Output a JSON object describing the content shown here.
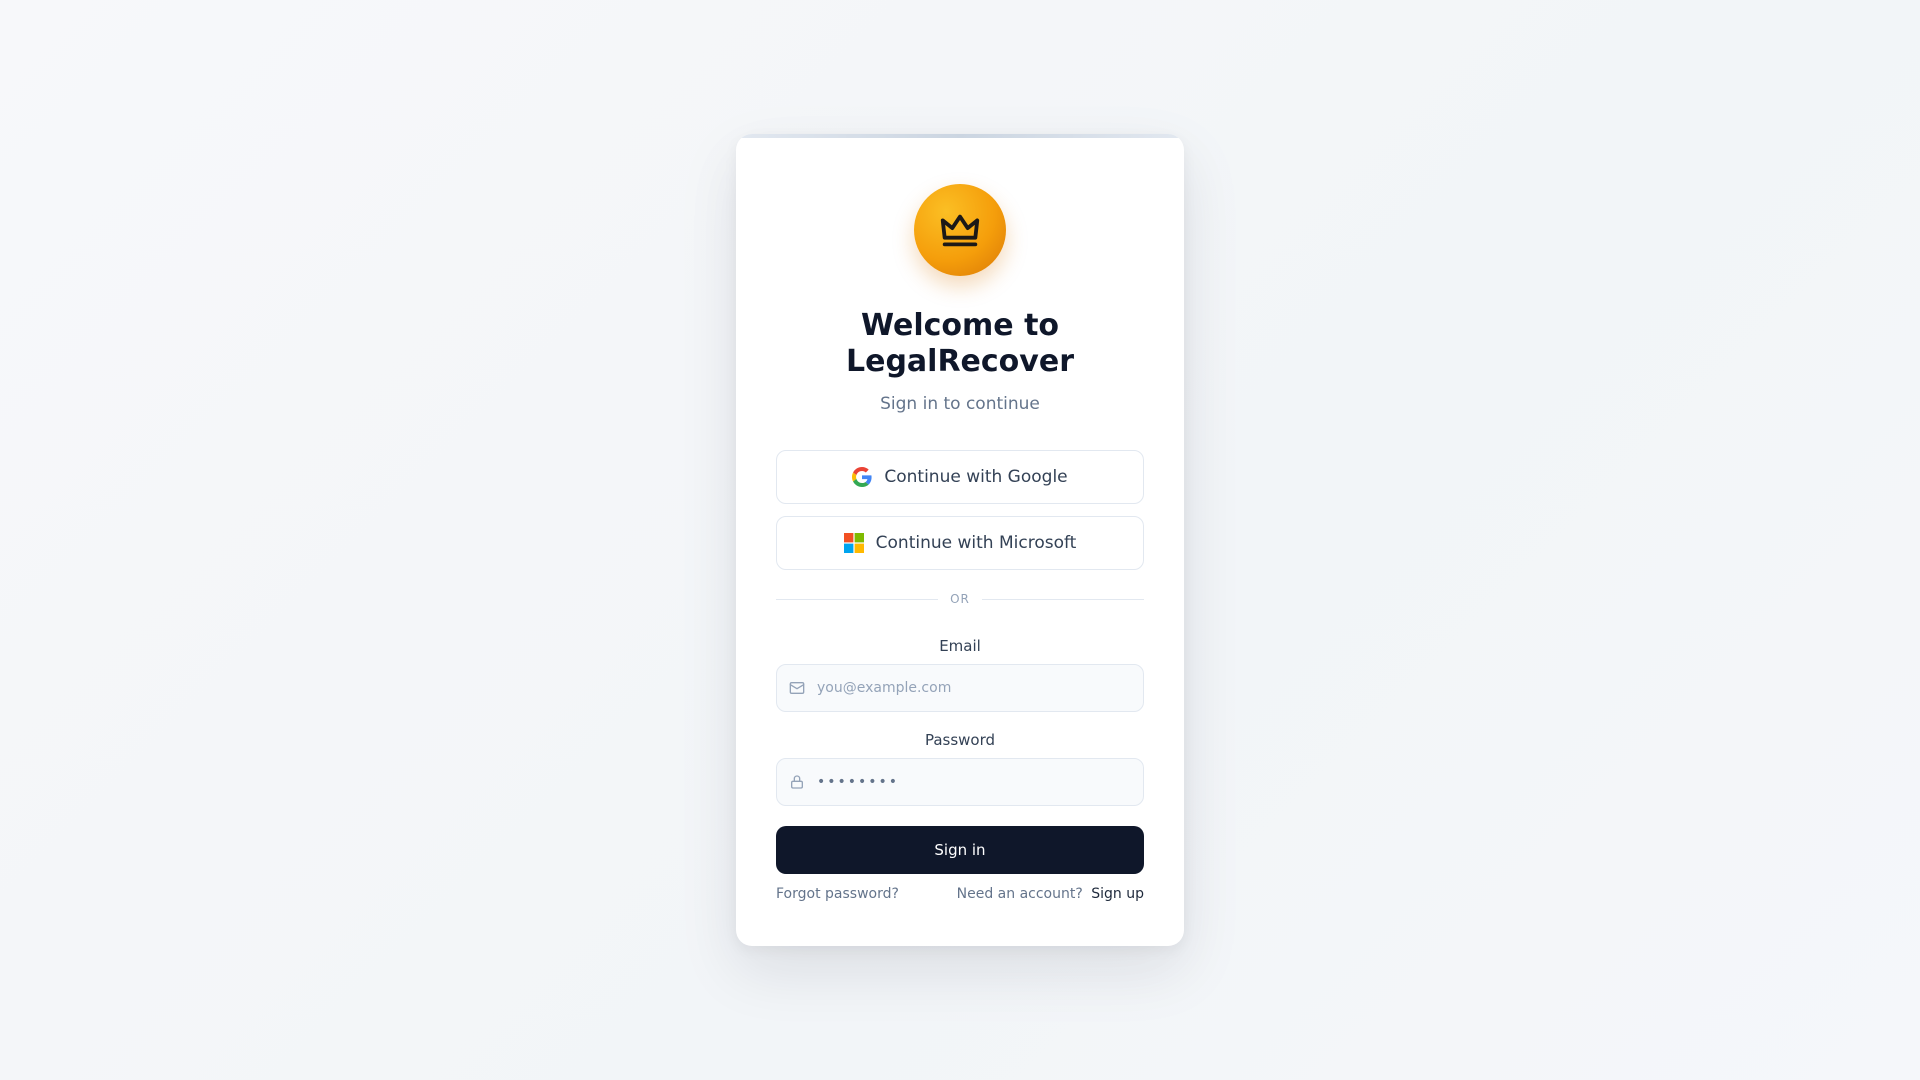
{
  "brand": {
    "logo_icon": "crown-icon",
    "accent_color": "#f59e0b"
  },
  "header": {
    "title": "Welcome to\nLegalRecover",
    "subtitle": "Sign in to continue"
  },
  "oauth": {
    "google_label": "Continue with Google",
    "google_icon": "google-icon",
    "microsoft_label": "Continue with Microsoft",
    "microsoft_icon": "microsoft-icon"
  },
  "divider": {
    "label": "OR"
  },
  "form": {
    "email_label": "Email",
    "email_placeholder": "you@example.com",
    "email_icon": "mail-icon",
    "password_label": "Password",
    "password_placeholder": "••••••••",
    "password_icon": "lock-icon",
    "submit_label": "Sign in",
    "submit_color": "#0f172a"
  },
  "footer": {
    "forgot_label": "Forgot password?",
    "signup_prompt": "Need an account?",
    "signup_label": "Sign up"
  }
}
